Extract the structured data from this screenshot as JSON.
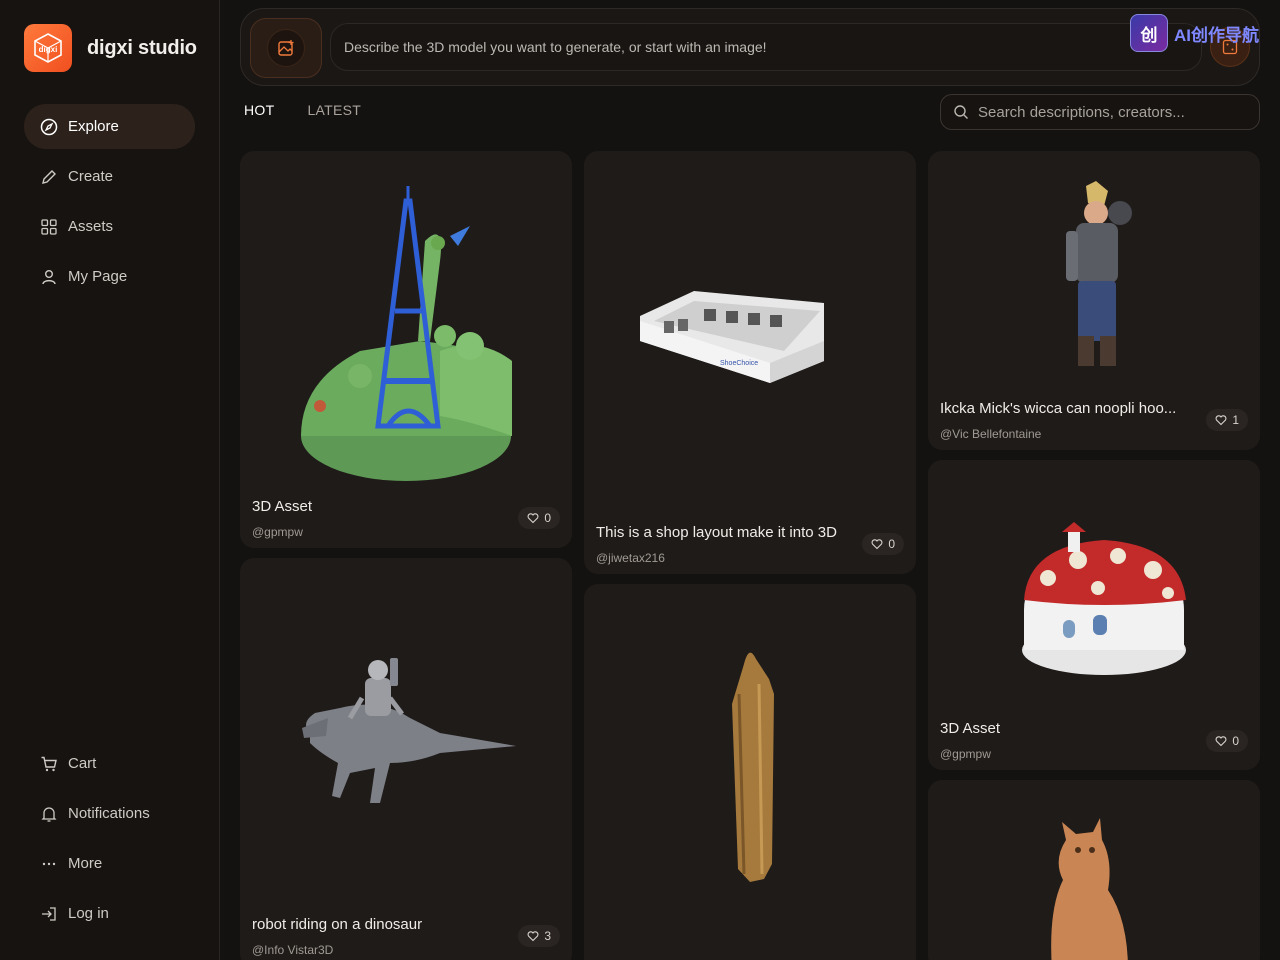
{
  "brand": {
    "name": "digxi studio",
    "logo_text": "digxi"
  },
  "nav": [
    {
      "label": "Explore",
      "icon": "compass-icon",
      "active": true
    },
    {
      "label": "Create",
      "icon": "pencil-icon",
      "active": false
    },
    {
      "label": "Assets",
      "icon": "grid-icon",
      "active": false
    },
    {
      "label": "My Page",
      "icon": "user-icon",
      "active": false
    }
  ],
  "bottom_nav": [
    {
      "label": "Cart",
      "icon": "cart-icon"
    },
    {
      "label": "Notifications",
      "icon": "bell-icon"
    },
    {
      "label": "More",
      "icon": "more-icon"
    },
    {
      "label": "Log in",
      "icon": "login-icon"
    }
  ],
  "prompt": {
    "placeholder": "Describe the 3D model you want to generate, or start with an image!"
  },
  "watermark": {
    "badge": "创",
    "text": "AI创作导航"
  },
  "tabs": [
    {
      "label": "HOT",
      "active": true
    },
    {
      "label": "LATEST",
      "active": false
    }
  ],
  "search": {
    "placeholder": "Search descriptions, creators..."
  },
  "cards": [
    {
      "title": "3D Asset",
      "author": "@gpmpw",
      "likes": "0",
      "art": "eiffel-tower-garden"
    },
    {
      "title": "robot riding on a dinosaur",
      "author": "@Info Vistar3D",
      "likes": "3",
      "art": "robot-dinosaur"
    },
    {
      "title": "This is a shop layout make it into 3D",
      "author": "@jiwetax216",
      "likes": "0",
      "art": "shop-layout"
    },
    {
      "title": "",
      "author": "",
      "likes": "",
      "art": "golden-frame"
    },
    {
      "title": "Ikcka Mick's wicca can noopli hoo...",
      "author": "@Vic Bellefontaine",
      "likes": "1",
      "art": "armored-warrior"
    },
    {
      "title": "3D Asset",
      "author": "@gpmpw",
      "likes": "0",
      "art": "mushroom-house"
    },
    {
      "title": "",
      "author": "",
      "likes": "",
      "art": "orange-cat"
    }
  ],
  "colors": {
    "accent": "#f05a24",
    "background": "#141210",
    "card": "#1f1b19"
  }
}
